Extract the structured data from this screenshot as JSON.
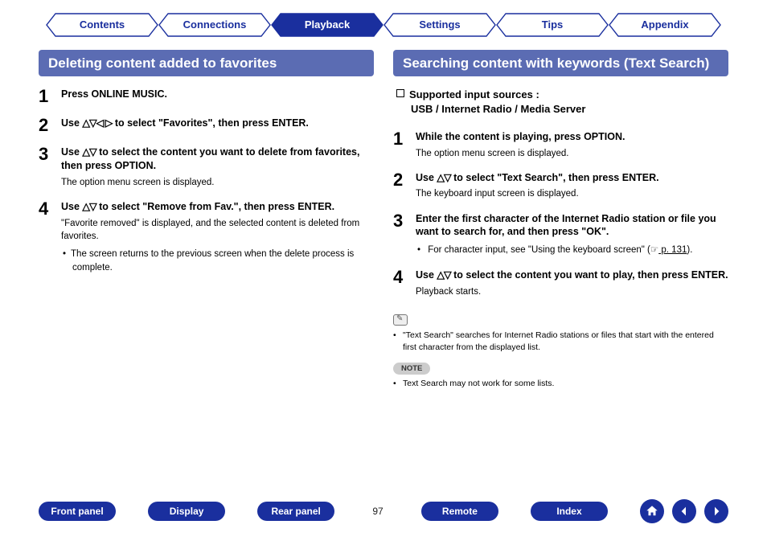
{
  "tabs": {
    "contents": "Contents",
    "connections": "Connections",
    "playback": "Playback",
    "settings": "Settings",
    "tips": "Tips",
    "appendix": "Appendix"
  },
  "left": {
    "title": "Deleting content added to favorites",
    "s1": "Press ONLINE MUSIC.",
    "s2a": "Use ",
    "s2b": " to select \"Favorites\", then press ENTER.",
    "s3a": "Use ",
    "s3b": " to select the content you want to delete from favorites, then press OPTION.",
    "s3sub": "The option menu screen is displayed.",
    "s4a": "Use ",
    "s4b": " to select \"Remove from Fav.\", then press ENTER.",
    "s4sub": "\"Favorite removed\" is displayed, and the selected content is deleted from favorites.",
    "s4li": "The screen returns to the previous screen when the delete process is complete."
  },
  "right": {
    "title": "Searching content with keywords (Text Search)",
    "subhead1": "Supported input sources :",
    "subhead2": "USB / Internet Radio / Media Server",
    "s1": "While the content is playing, press OPTION.",
    "s1sub": "The option menu screen is displayed.",
    "s2a": "Use ",
    "s2b": " to select \"Text Search\", then press ENTER.",
    "s2sub": "The keyboard input screen is displayed.",
    "s3": "Enter the first character of the Internet Radio station or file you want to search for, and then press \"OK\".",
    "s3li_a": "For character input, see \"Using the keyboard screen\" (",
    "s3li_link": " p. 131",
    "s3li_b": ").",
    "s4a": "Use ",
    "s4b": " to select the content you want to play, then press ENTER.",
    "s4sub": "Playback starts.",
    "tip": "\"Text Search\" searches for Internet Radio stations or files that start with the entered first character from the displayed list.",
    "note_label": "NOTE",
    "note": "Text Search may not work for some lists."
  },
  "icons": {
    "all4": "△▽◁ ▷",
    "updown": "△▽",
    "hand": "☞"
  },
  "footer": {
    "front_panel": "Front panel",
    "display": "Display",
    "rear_panel": "Rear panel",
    "page": "97",
    "remote": "Remote",
    "index": "Index"
  }
}
